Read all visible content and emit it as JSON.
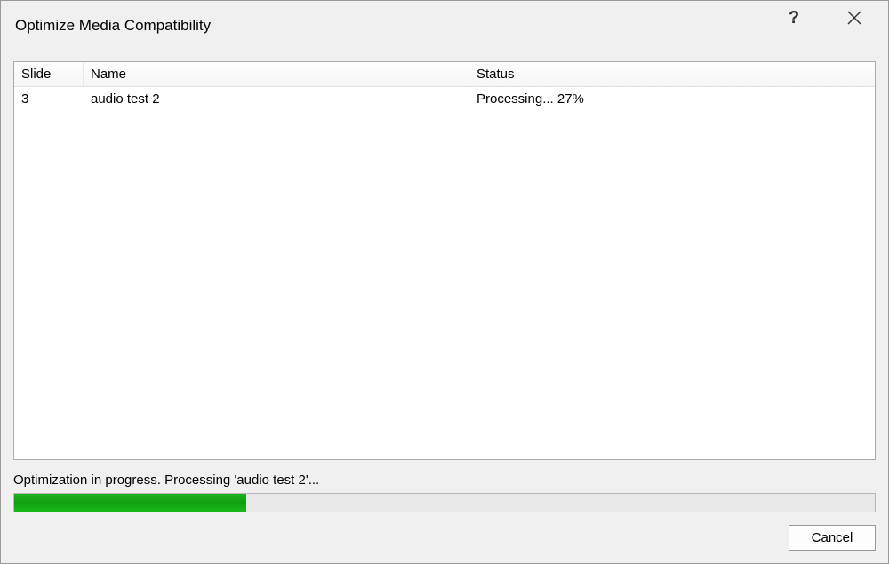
{
  "dialog": {
    "title": "Optimize Media Compatibility",
    "help_icon": "?",
    "close_icon": "✕"
  },
  "table": {
    "headers": {
      "slide": "Slide",
      "name": "Name",
      "status": "Status"
    },
    "rows": [
      {
        "slide": "3",
        "name": "audio test 2",
        "status": "Processing... 27%"
      }
    ]
  },
  "progress": {
    "status_text": "Optimization in progress. Processing 'audio test 2'...",
    "percent": "27"
  },
  "buttons": {
    "cancel": "Cancel"
  }
}
